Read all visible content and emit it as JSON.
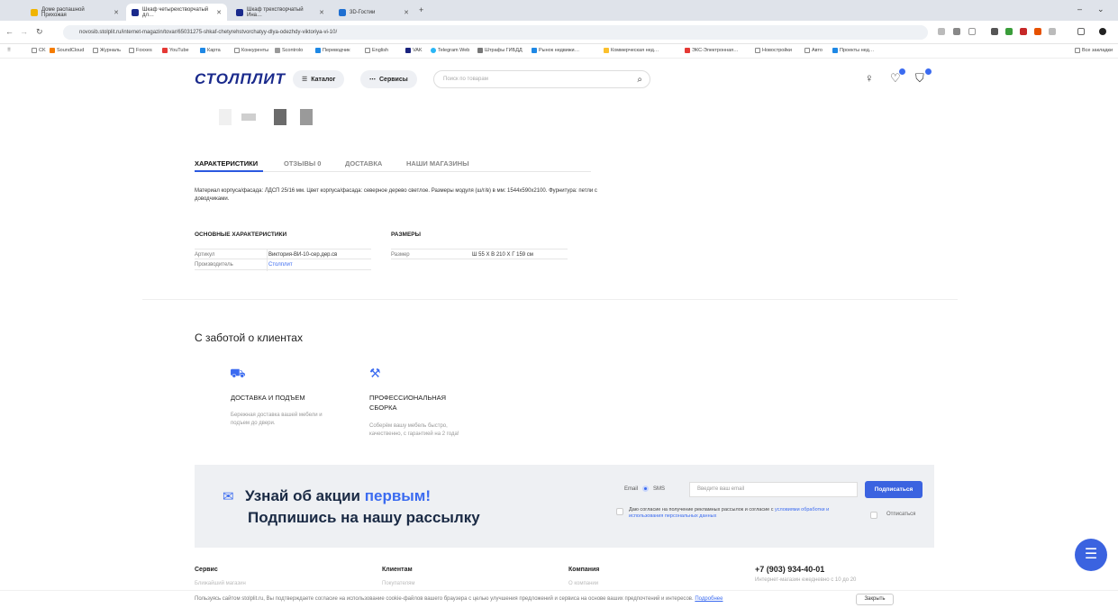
{
  "browser": {
    "tabs": [
      {
        "title": "Доме распашной Прихожая",
        "active": false
      },
      {
        "title": "Шкаф четырехстворчатый дл…",
        "active": true
      },
      {
        "title": "Шкаф трехстворчатый Ина…",
        "active": false
      },
      {
        "title": "3D-Гостии",
        "active": false
      }
    ],
    "new_tab": "+",
    "url": "novosib.stolplit.ru/internet-magazin/tovar/65031275-shkaf-chetyrehstvorchatyy-dlya-odezhdy-viktoriya-vi-10/",
    "window_controls": [
      "–",
      "⌄"
    ]
  },
  "bookmarks": [
    "CK",
    "SoundCloud",
    "Журналь",
    "Foxxes",
    "YouTube",
    "Карта",
    "Конкуренты",
    "Scontrolo",
    "Переводчик",
    "English",
    "VAK",
    "Telegram Web",
    "Штрафы ГИБДД",
    "Рынок недвижи…",
    "Коммерческая нед…",
    "ЭКС-Электронная…",
    "Новостройки",
    "Авто",
    "Проекты нед…",
    "Все закладки"
  ],
  "header": {
    "logo": "СТОЛПЛИТ",
    "catalog": "Каталог",
    "services": "Сервисы",
    "search_placeholder": "Поиск по товарам"
  },
  "product_tabs": {
    "items": [
      "ХАРАКТЕРИСТИКИ",
      "ОТЗЫВЫ 0",
      "ДОСТАВКА",
      "НАШИ МАГАЗИНЫ"
    ],
    "active": 0
  },
  "description": "Материал корпуса/фасада: ЛДСП 25/16 мм. Цвет корпуса/фасада: северное дерево светлое. Размеры модуля (ш/г/в) в мм: 1544х590х2100. Фурнитура: петли с доводчиками.",
  "main_chars": {
    "title": "ОСНОВНЫЕ ХАРАКТЕРИСТИКИ",
    "rows": [
      {
        "key": "Артикул",
        "value": "Виктория-ВИ-10-сер.дер.св"
      },
      {
        "key": "Производитель",
        "value": "Столплит"
      }
    ]
  },
  "sizes": {
    "title": "РАЗМЕРЫ",
    "rows": [
      {
        "key": "Размер",
        "value": "Ш 55 Х В 210 Х Г 159 см"
      }
    ]
  },
  "care": {
    "title": "С заботой о клиентах",
    "delivery": {
      "title": "ДОСТАВКА И ПОДЪЕМ",
      "text": "Бережная доставка вашей мебели и подъем до двери."
    },
    "assembly": {
      "title": "ПРОФЕССИОНАЛЬНАЯ СБОРКА",
      "text": "Соберём вашу мебель быстро, качественно, с гарантией на 2 года!"
    }
  },
  "newsletter": {
    "line1_prefix": "Узнай об акции",
    "line1_accent": "первым!",
    "line2": "Подпишись на нашу рассылку",
    "opt_email": "Email",
    "opt_sms": "SMS",
    "email_placeholder": "Введите ваш email",
    "subscribe": "Подписаться",
    "consent_text": "Даю согласие на получение рекламных рассылок и согласие с",
    "consent_link": "условиями обработки и использования персональных данных",
    "unsubscribe": "Отписаться"
  },
  "footer": {
    "cols": [
      {
        "title": "Сервис",
        "first": "Ближайший магазин"
      },
      {
        "title": "Клиентам",
        "first": "Покупателям"
      },
      {
        "title": "Компания",
        "first": "О компании"
      }
    ],
    "phone": "+7 (903) 934-40-01",
    "phone_sub": "Интернет-магазин ежедневно с 10 до 20"
  },
  "cookie": {
    "text": "Пользуясь сайтом stolplit.ru, Вы подтверждаете согласие на использование cookie-файлов вашего браузера с целью улучшения предложений и сервиса на основе ваших предпочтений и интересов.",
    "link": "Подробнее",
    "button": "Закрыть"
  },
  "colors": {
    "accent": "#3b6bf0",
    "logo": "#1a2a8c"
  }
}
